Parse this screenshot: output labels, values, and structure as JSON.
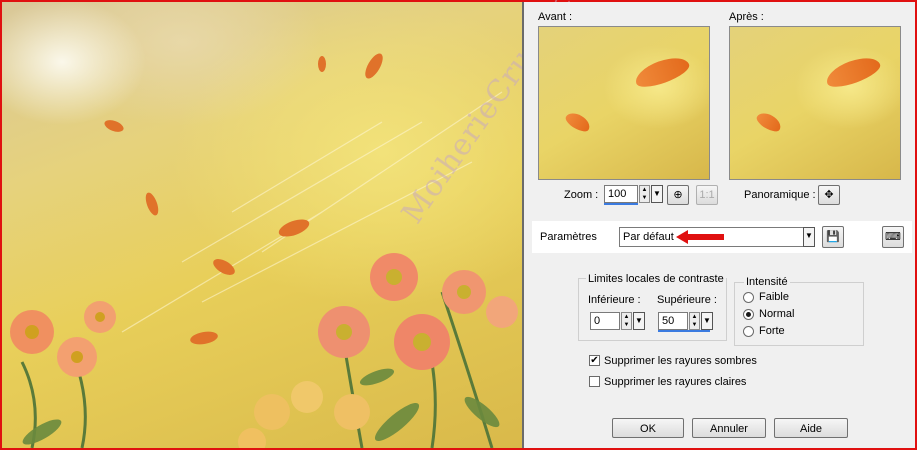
{
  "panel": {
    "before_label": "Avant :",
    "after_label": "Après :",
    "zoom_label": "Zoom :",
    "zoom_value": "100",
    "panoramic_label": "Panoramique :",
    "params_label": "Paramètres",
    "preset_value": "Par défaut",
    "contrast_group_title": "Limites locales de contraste",
    "lower_label": "Inférieure :",
    "lower_value": "0",
    "upper_label": "Supérieure :",
    "upper_value": "50",
    "intensity_group_title": "Intensité",
    "intensity_options": [
      "Faible",
      "Normal",
      "Forte"
    ],
    "intensity_selected": "Normal",
    "checkbox_dark": "Supprimer les rayures sombres",
    "checkbox_dark_checked": true,
    "checkbox_light": "Supprimer les rayures claires",
    "checkbox_light_checked": false,
    "ok_label": "OK",
    "cancel_label": "Annuler",
    "help_label": "Aide"
  },
  "watermark": "MoiherieCruuhic",
  "colors": {
    "frame_border": "#e01010",
    "arrow": "#e01010",
    "selection_blue": "#3b7be0"
  }
}
